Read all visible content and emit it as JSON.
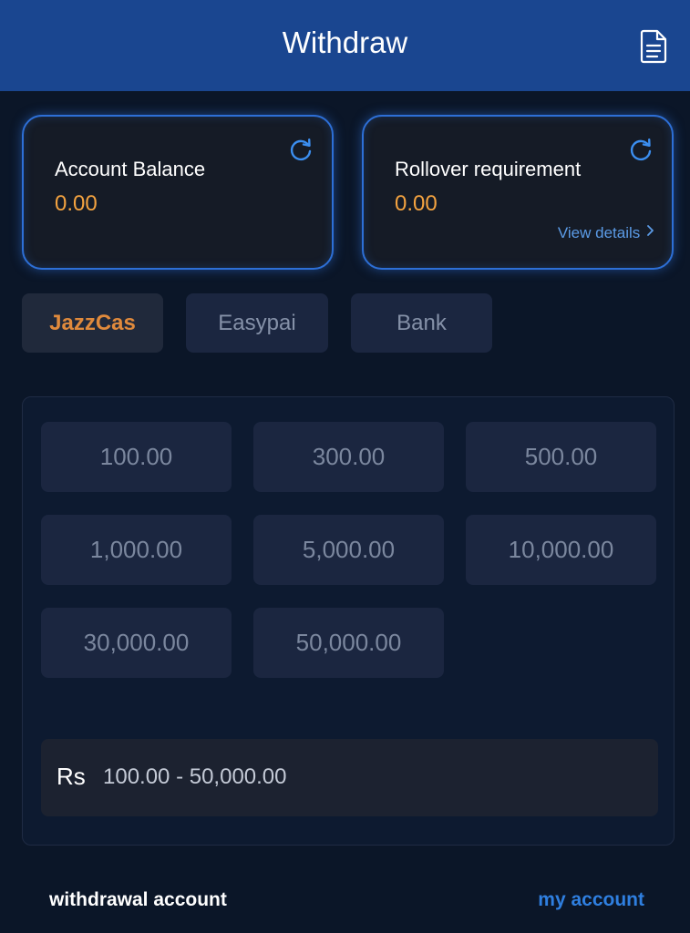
{
  "header": {
    "title": "Withdraw",
    "record_icon": "document-icon"
  },
  "cards": {
    "balance": {
      "label": "Account Balance",
      "value": "0.00",
      "icon": "refresh-icon"
    },
    "rollover": {
      "label": "Rollover requirement",
      "value": "0.00",
      "icon": "refresh-icon",
      "link": "View details",
      "link_icon": "chevron-right-icon"
    }
  },
  "tabs": [
    {
      "label": "JazzCas",
      "selected": true
    },
    {
      "label": "Easypai",
      "selected": false
    },
    {
      "label": "Bank",
      "selected": false
    }
  ],
  "amounts": [
    "100.00",
    "300.00",
    "500.00",
    "1,000.00",
    "5,000.00",
    "10,000.00",
    "30,000.00",
    "50,000.00"
  ],
  "amount_input": {
    "currency": "Rs",
    "placeholder": "100.00 - 50,000.00",
    "value": ""
  },
  "footer": {
    "left": "withdrawal account",
    "right": "my account"
  },
  "colors": {
    "header_bg": "#1a4690",
    "accent_orange": "#f4a340",
    "accent_blue": "#2f7fe0",
    "page_bg": "#0b1628"
  }
}
